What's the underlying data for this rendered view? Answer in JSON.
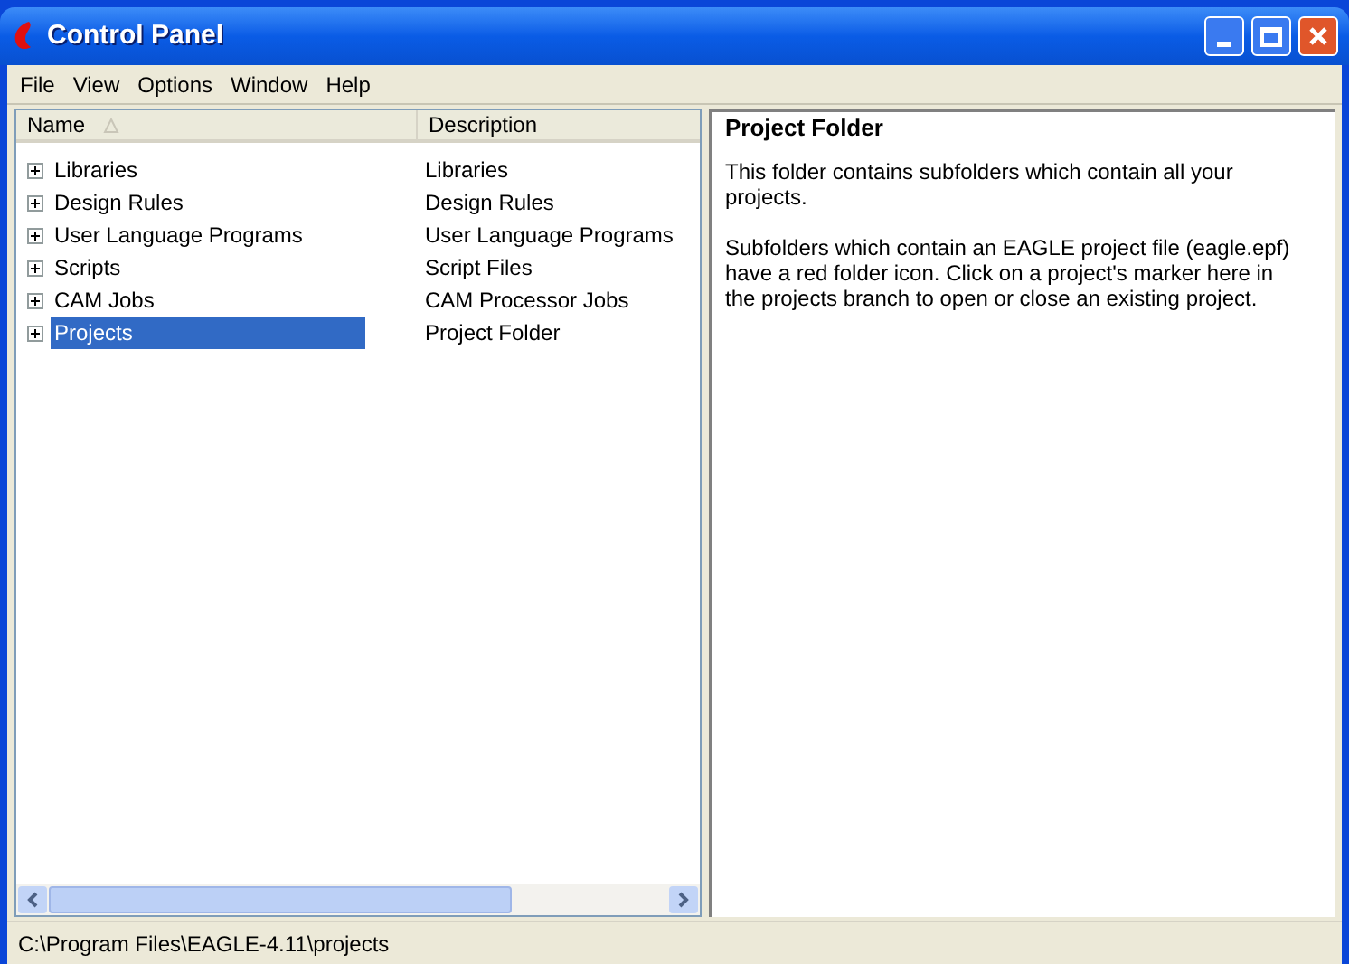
{
  "window": {
    "title": "Control Panel"
  },
  "menu": [
    "File",
    "View",
    "Options",
    "Window",
    "Help"
  ],
  "tree": {
    "columns": [
      {
        "label": "Name",
        "sorted": true
      },
      {
        "label": "Description",
        "sorted": false
      }
    ],
    "rows": [
      {
        "name": "Libraries",
        "description": "Libraries",
        "selected": false,
        "expanded": false
      },
      {
        "name": "Design Rules",
        "description": "Design Rules",
        "selected": false,
        "expanded": false
      },
      {
        "name": "User Language Programs",
        "description": "User Language Programs",
        "selected": false,
        "expanded": false
      },
      {
        "name": "Scripts",
        "description": "Script Files",
        "selected": false,
        "expanded": false
      },
      {
        "name": "CAM Jobs",
        "description": "CAM Processor Jobs",
        "selected": false,
        "expanded": false
      },
      {
        "name": "Projects",
        "description": "Project Folder",
        "selected": true,
        "expanded": false
      }
    ]
  },
  "info": {
    "title": "Project Folder",
    "paragraphs": [
      "This folder contains subfolders which contain all your projects.",
      "Subfolders which contain an EAGLE project file (eagle.epf) have a red folder icon. Click on a project's marker here in the projects branch to open or close an existing project."
    ]
  },
  "status_bar": "C:\\Program Files\\EAGLE-4.11\\projects"
}
